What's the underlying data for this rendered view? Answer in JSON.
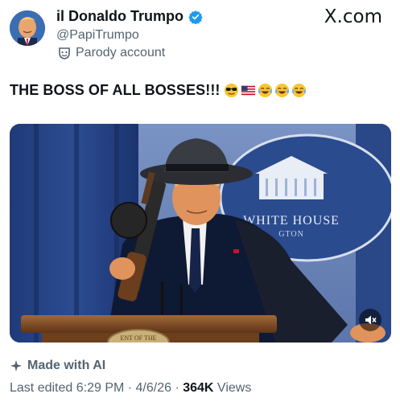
{
  "account": {
    "display_name": "il Donaldo Trumpo",
    "handle": "@PapiTrumpo",
    "parody_label": "Parody account",
    "verified": true
  },
  "watermark": "X.com",
  "post": {
    "text": "THE BOSS OF ALL BOSSES!!!",
    "emojis": [
      "sunglasses-face",
      "us-flag",
      "tears-of-joy",
      "tears-of-joy",
      "tears-of-joy"
    ]
  },
  "media": {
    "sign_text": "WHITE HOUSE",
    "sign_subtext": "GTON",
    "podium_text": "ENT OF THE"
  },
  "footer": {
    "ai_label": "Made with AI",
    "last_edited": "Last edited 6:29 PM",
    "sep1": " · ",
    "date": "4/6/26",
    "sep2": " · ",
    "views_count": "364K",
    "views_label": " Views"
  },
  "colors": {
    "text": "#0f1419",
    "secondary": "#536471",
    "verified": "#1d9bf0"
  }
}
